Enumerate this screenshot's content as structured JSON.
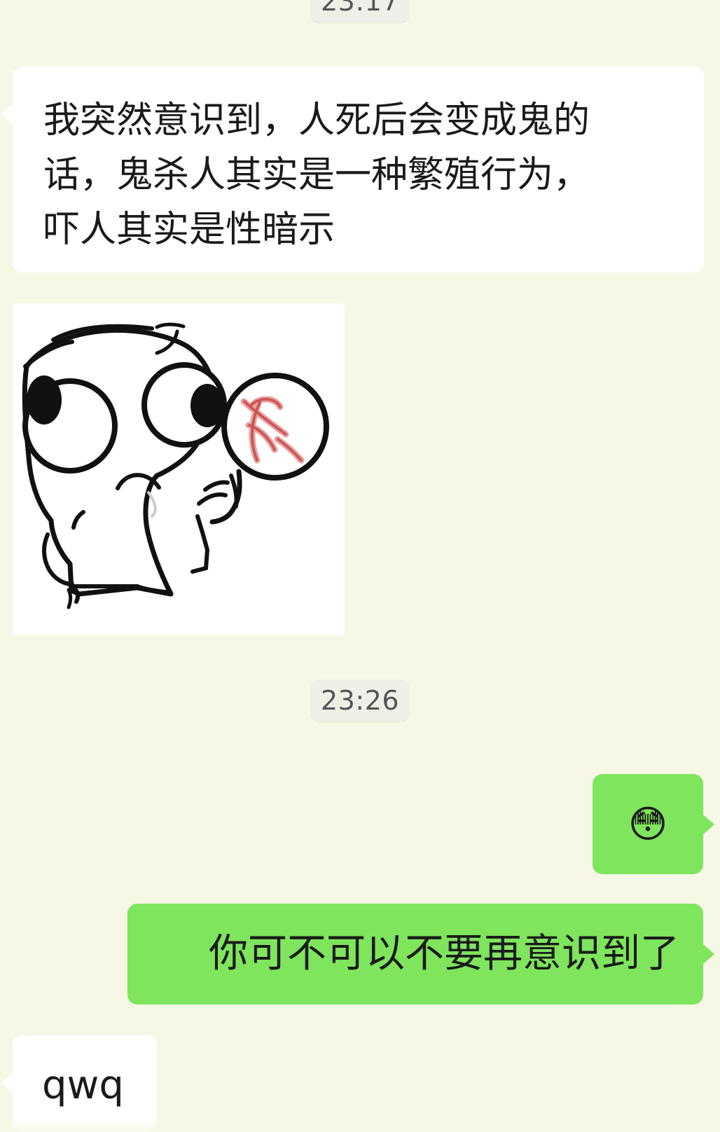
{
  "timestamps": [
    "23:17",
    "23:26"
  ],
  "messages": {
    "incoming_1": "我突然意识到，人死后会变成鬼的\n话，鬼杀人其实是一种繁殖行为，\n吓人其实是性暗示",
    "outgoing_emoji": "😳",
    "outgoing_reply": "你可不可以不要再意识到了",
    "incoming_last": "qwq"
  },
  "colors": {
    "background": "#f7f7e6",
    "incoming_bubble": "#ffffff",
    "outgoing_bubble": "#7ee55c",
    "time_pill": "#efefe8"
  },
  "icons": {
    "sticker": "shocked-cartoon-sticker",
    "emoji": "flushed-face-icon"
  }
}
